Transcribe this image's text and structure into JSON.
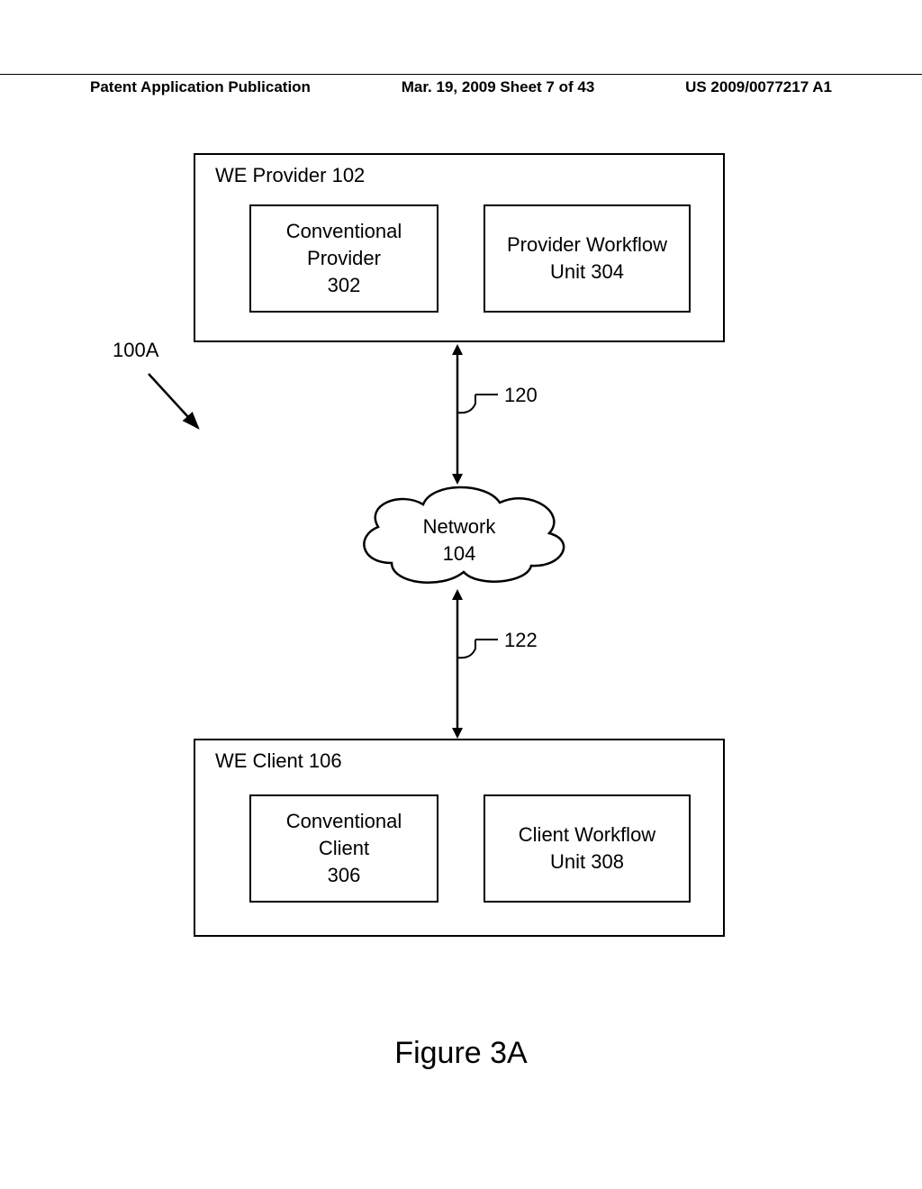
{
  "header": {
    "left": "Patent Application Publication",
    "center": "Mar. 19, 2009  Sheet 7 of 43",
    "right": "US 2009/0077217 A1"
  },
  "provider": {
    "title": "WE Provider 102",
    "conv": "Conventional\nProvider\n302",
    "workflow": "Provider Workflow\nUnit 304"
  },
  "client": {
    "title": "WE Client 106",
    "conv": "Conventional\nClient\n306",
    "workflow": "Client Workflow\nUnit 308"
  },
  "network": "Network\n104",
  "labels": {
    "system": "100A",
    "topConn": "120",
    "botConn": "122"
  },
  "caption": "Figure 3A"
}
